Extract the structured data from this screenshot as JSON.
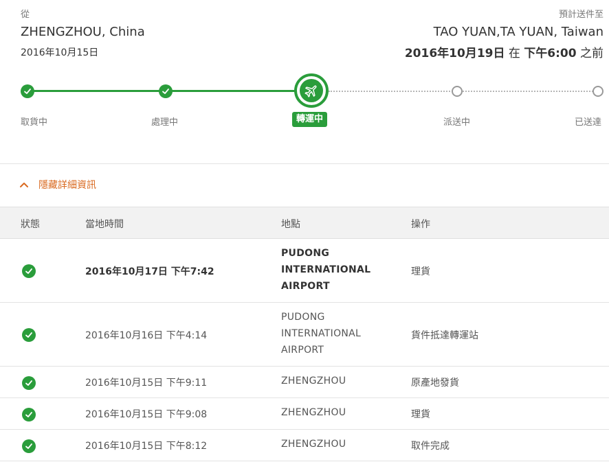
{
  "shipment": {
    "from_label": "從",
    "origin_city": "ZHENGZHOU, China",
    "origin_date": "2016年10月15日",
    "eta_label": "預計送件至",
    "destination_city": "TAO YUAN,TA YUAN, Taiwan",
    "eta_date": "2016年10月19日",
    "eta_at": "在",
    "eta_time": "下午6:00",
    "eta_suffix": "之前"
  },
  "progress": {
    "steps": [
      {
        "label": "取貨中",
        "state": "done"
      },
      {
        "label": "處理中",
        "state": "done"
      },
      {
        "label": "轉運中",
        "state": "current",
        "icon": "airplane-icon"
      },
      {
        "label": "派送中",
        "state": "pending"
      },
      {
        "label": "已送達",
        "state": "pending"
      }
    ],
    "colors": {
      "done": "#2a9d3b",
      "pending": "#999999"
    }
  },
  "details": {
    "toggle_label": "隱藏詳細資訊",
    "toggle_color": "#d9691f"
  },
  "table": {
    "headers": [
      "狀態",
      "當地時間",
      "地點",
      "操作"
    ],
    "rows": [
      {
        "datetime": "2016年10月17日 下午7:42",
        "location_lines": [
          "PUDONG",
          "INTERNATIONAL",
          "AIRPORT"
        ],
        "action": "理貨",
        "status_icon": "check-circle-icon",
        "latest": true
      },
      {
        "datetime": "2016年10月16日 下午4:14",
        "location_lines": [
          "PUDONG",
          "INTERNATIONAL",
          "AIRPORT"
        ],
        "action": "貨件抵達轉運站",
        "status_icon": "check-circle-icon",
        "latest": false
      },
      {
        "datetime": "2016年10月15日 下午9:11",
        "location_lines": [
          "ZHENGZHOU"
        ],
        "action": "原產地發貨",
        "status_icon": "check-circle-icon",
        "latest": false
      },
      {
        "datetime": "2016年10月15日 下午9:08",
        "location_lines": [
          "ZHENGZHOU"
        ],
        "action": "理貨",
        "status_icon": "check-circle-icon",
        "latest": false
      },
      {
        "datetime": "2016年10月15日 下午8:12",
        "location_lines": [
          "ZHENGZHOU"
        ],
        "action": "取件完成",
        "status_icon": "check-circle-icon",
        "latest": false
      }
    ]
  }
}
